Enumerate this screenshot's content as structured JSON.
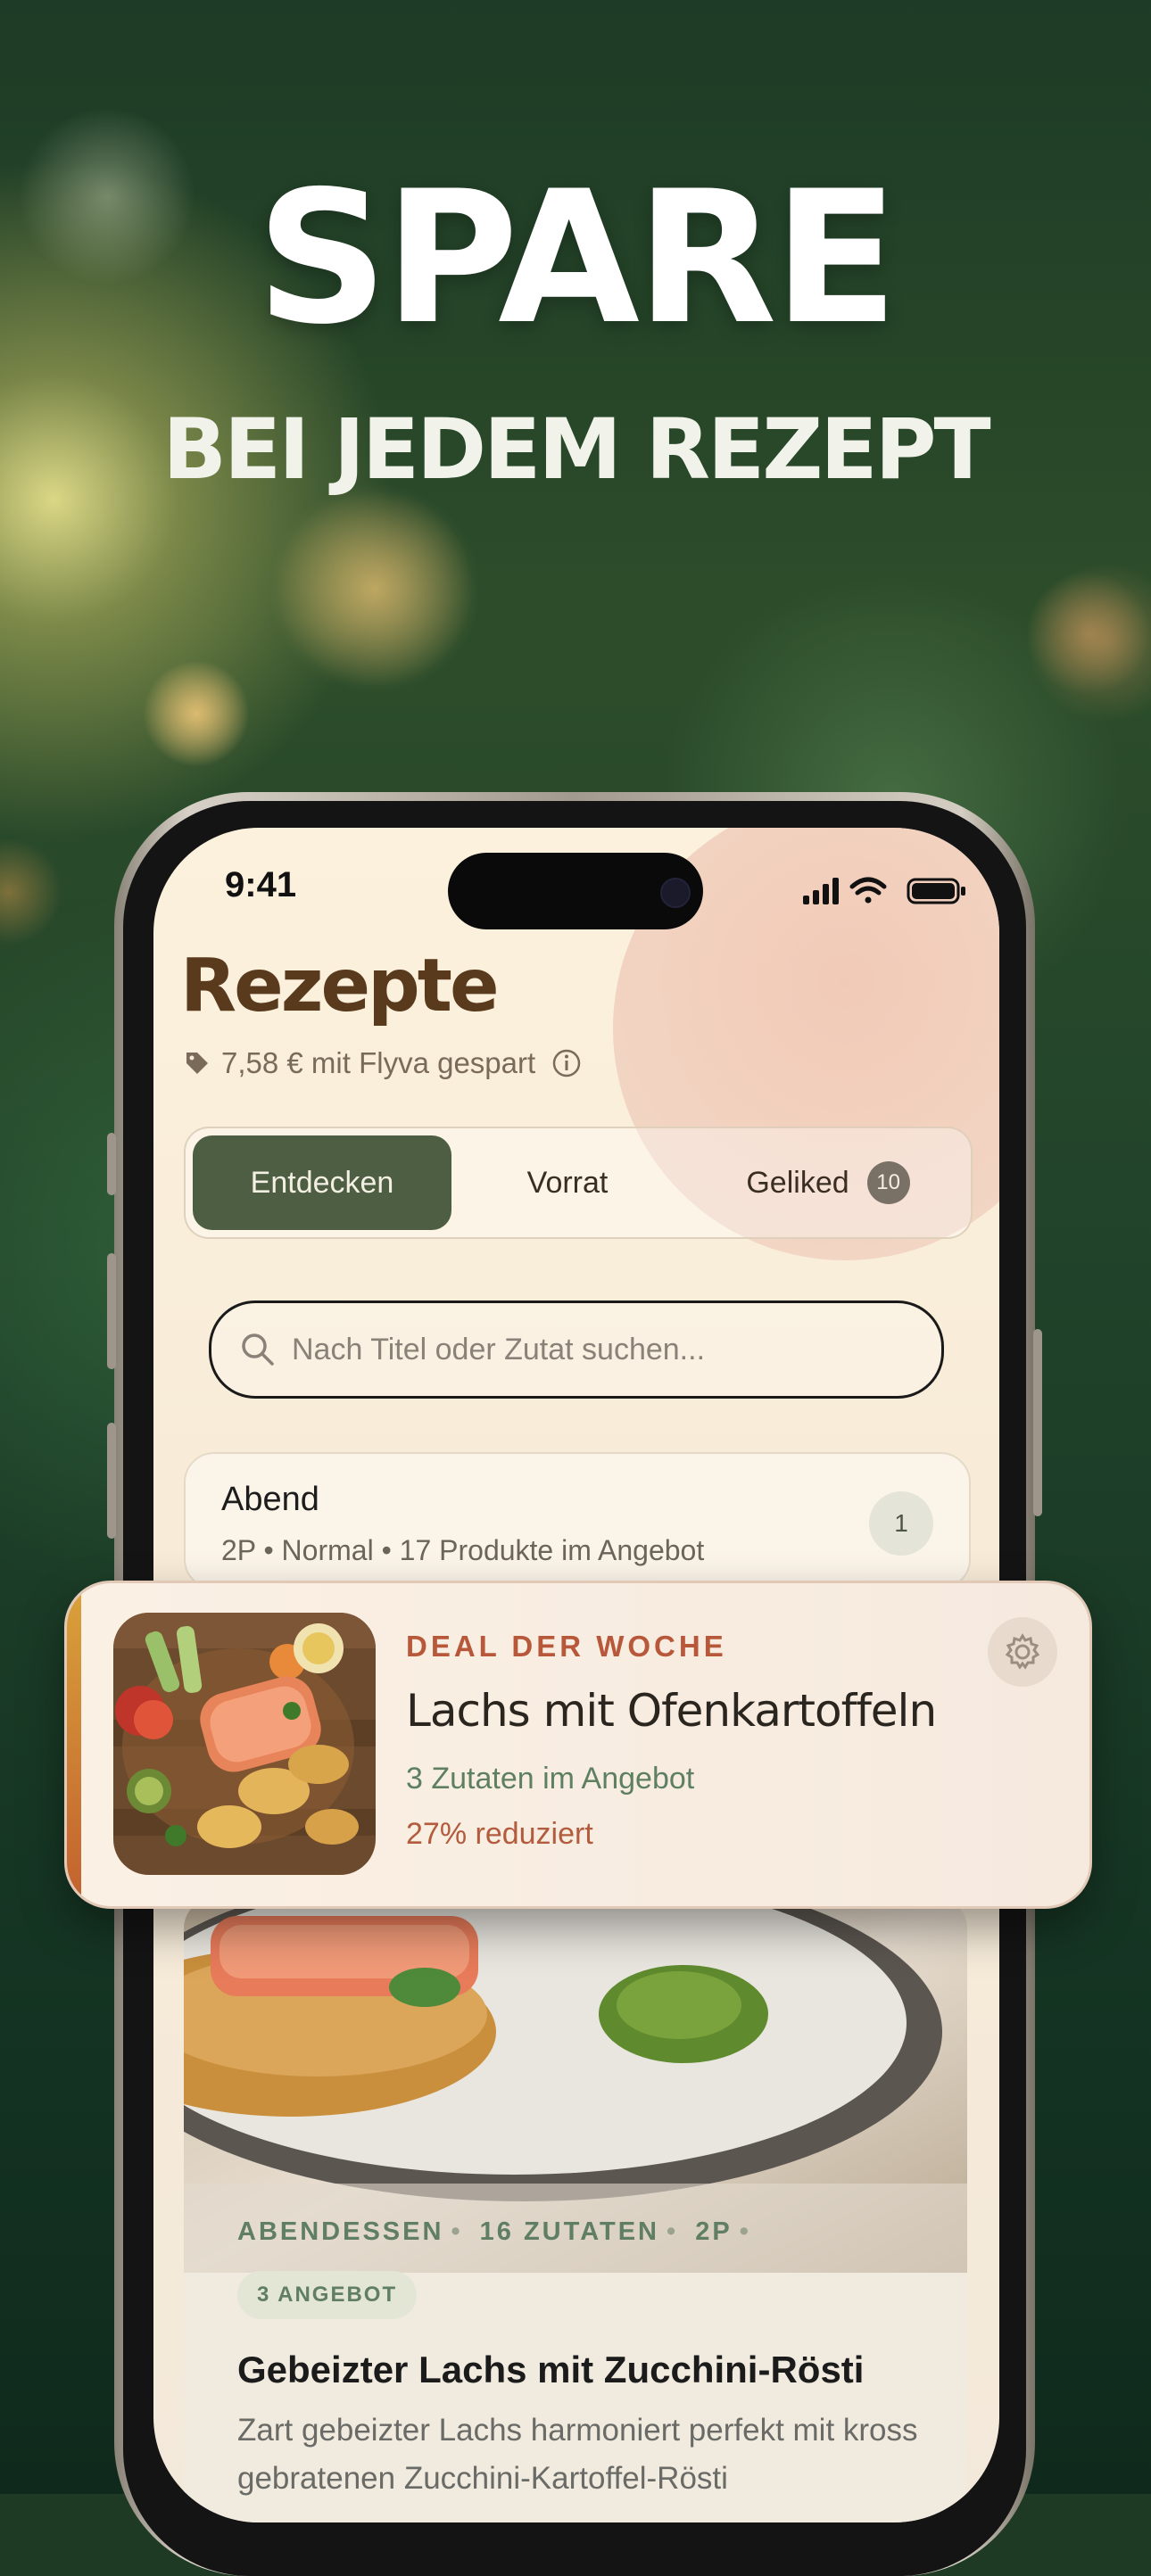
{
  "marketing": {
    "headline": "SPARE",
    "subheadline": "BEI JEDEM REZEPT"
  },
  "status_bar": {
    "time": "9:41"
  },
  "page": {
    "title": "Rezepte",
    "savings_text": "7,58 € mit Flyva gespart"
  },
  "tabs": [
    {
      "label": "Entdecken",
      "active": true
    },
    {
      "label": "Vorrat",
      "active": false
    },
    {
      "label": "Geliked",
      "active": false,
      "badge": "10"
    }
  ],
  "search": {
    "placeholder": "Nach Titel oder Zutat suchen..."
  },
  "meal_group": {
    "title": "Abend",
    "subtitle": "2P • Normal • 17 Produkte im Angebot",
    "count": "1"
  },
  "deal": {
    "label": "DEAL DER WOCHE",
    "title": "Lachs mit Ofenkartoffeln",
    "ingredients_on_sale": "3 Zutaten im Angebot",
    "discount": "27% reduziert"
  },
  "recipe": {
    "meta": [
      "ABENDESSEN",
      "16 ZUTATEN",
      "2P"
    ],
    "offer_badge": "3 ANGEBOT",
    "title": "Gebeizter Lachs mit Zucchini-Rösti",
    "description": "Zart gebeizter Lachs harmoniert perfekt mit kross gebratenen Zucchini-Kartoffel-Rösti"
  },
  "colors": {
    "brand_brown": "#5a3a1c",
    "active_tab": "#4d5e43",
    "deal_accent": "#b8583b",
    "sale_green": "#5e8060"
  },
  "icons": [
    "signal-icon",
    "wifi-icon",
    "battery-icon",
    "tag-icon",
    "info-icon",
    "search-icon",
    "settings-icon"
  ]
}
